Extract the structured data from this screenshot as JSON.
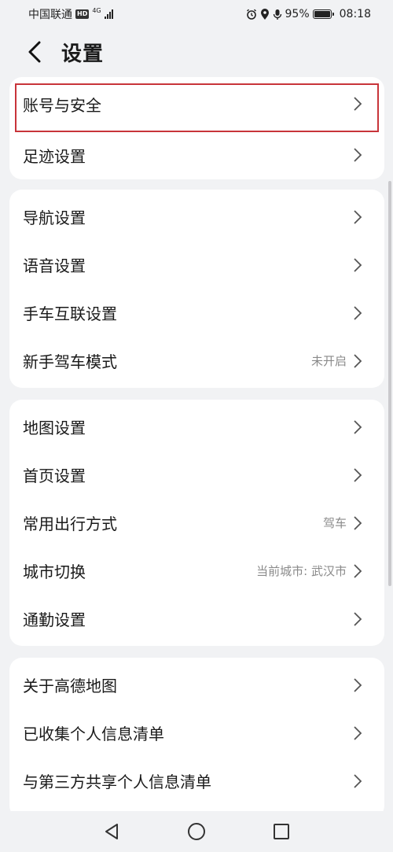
{
  "status": {
    "carrier": "中国联通",
    "hd": "HD",
    "network": "4G",
    "battery": "95%",
    "time": "08:18"
  },
  "header": {
    "title": "设置"
  },
  "groups": [
    {
      "items": [
        {
          "label": "账号与安全",
          "value": ""
        },
        {
          "label": "足迹设置",
          "value": ""
        }
      ]
    },
    {
      "items": [
        {
          "label": "导航设置",
          "value": ""
        },
        {
          "label": "语音设置",
          "value": ""
        },
        {
          "label": "手车互联设置",
          "value": ""
        },
        {
          "label": "新手驾车模式",
          "value": "未开启"
        }
      ]
    },
    {
      "items": [
        {
          "label": "地图设置",
          "value": ""
        },
        {
          "label": "首页设置",
          "value": ""
        },
        {
          "label": "常用出行方式",
          "value": "驾车"
        },
        {
          "label": "城市切换",
          "value": "当前城市: 武汉市"
        },
        {
          "label": "通勤设置",
          "value": ""
        }
      ]
    },
    {
      "items": [
        {
          "label": "关于高德地图",
          "value": ""
        },
        {
          "label": "已收集个人信息清单",
          "value": ""
        },
        {
          "label": "与第三方共享个人信息清单",
          "value": ""
        }
      ]
    }
  ],
  "colors": {
    "highlight": "#c8343a",
    "background": "#f1f2f4",
    "card": "#ffffff"
  },
  "icons": [
    "back-arrow-icon",
    "chevron-right-icon",
    "alarm-icon",
    "location-icon",
    "mic-icon",
    "battery-icon",
    "nav-back-icon",
    "nav-home-icon",
    "nav-recents-icon"
  ]
}
